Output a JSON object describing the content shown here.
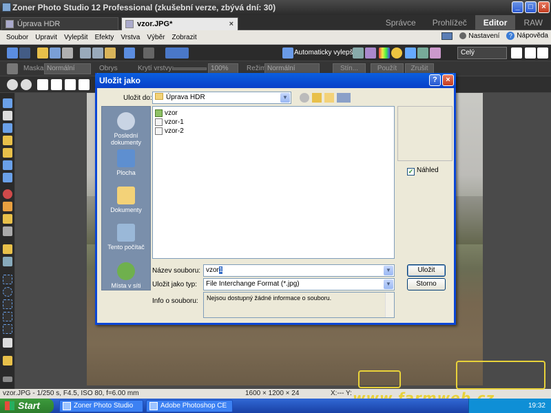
{
  "app": {
    "title": "Zoner Photo Studio 12 Professional (zkušební verze, zbývá dní: 30)",
    "window_buttons": [
      "_",
      "□",
      "×"
    ]
  },
  "tabs": {
    "documents": [
      {
        "label": "Úprava HDR",
        "active": false
      },
      {
        "label": "vzor.JPG*",
        "active": true
      }
    ],
    "close_glyph": "×",
    "modes": [
      {
        "label": "Správce",
        "active": false
      },
      {
        "label": "Prohlížeč",
        "active": false
      },
      {
        "label": "Editor",
        "active": true
      },
      {
        "label": "RAW",
        "active": false
      }
    ]
  },
  "menu": {
    "items": [
      "Soubor",
      "Upravit",
      "Vylepšit",
      "Efekty",
      "Vrstva",
      "Výběr",
      "Zobrazit"
    ],
    "settings": "Nastavení",
    "help": "Nápověda"
  },
  "toolbar": {
    "auto_enhance": "Automaticky vylepšit",
    "zoom_select": "Celý",
    "mask_label": "Maska:",
    "mask_value": "Normální",
    "outline_label": "Obrys",
    "opacity_label": "Krytí vrstvy:",
    "opacity_value": "100%",
    "mode_label": "Režim:",
    "mode_value": "Normální",
    "shadow_btn": "Stín...",
    "apply_btn": "Použít",
    "cancel_btn": "Zrušit"
  },
  "dialog": {
    "title": "Uložit jako",
    "buttons": [
      "?",
      "×"
    ],
    "save_in_label": "Uložit do:",
    "save_in_value": "Úprava HDR",
    "places": [
      "Poslední dokumenty",
      "Plocha",
      "Dokumenty",
      "Tento počítač",
      "Místa v síti"
    ],
    "files": [
      {
        "name": "vzor",
        "type": "folder"
      },
      {
        "name": "vzor-1",
        "type": "image"
      },
      {
        "name": "vzor-2",
        "type": "image"
      }
    ],
    "preview_label": "Náhled",
    "preview_checked": true,
    "filename_label": "Název souboru:",
    "filename_value": "vzor",
    "filename_selected": "1",
    "filetype_label": "Uložit jako typ:",
    "filetype_value": "File Interchange Format (*.jpg)",
    "info_label": "Info o souboru:",
    "info_value": "Nejsou dostupný žádné informace o souboru.",
    "save_button": "Uložit",
    "cancel_button": "Storno"
  },
  "statusbar": {
    "info": "vzor.JPG - 1/250 s, F4.5, ISO 80, f=6.00 mm",
    "dimensions": "1600 × 1200 × 24",
    "coords": "X:--- Y:"
  },
  "taskbar": {
    "start": "Start",
    "items": [
      "Zoner Photo Studio 1...",
      "Adobe Photoshop CE"
    ],
    "clock": "19:32"
  },
  "watermark": "www.farmweb.cz",
  "colors": {
    "xp_blue": "#0a46d6",
    "taskbar": "#245edb",
    "start_green": "#3c9a3c",
    "watermark": "#e8d23a"
  }
}
